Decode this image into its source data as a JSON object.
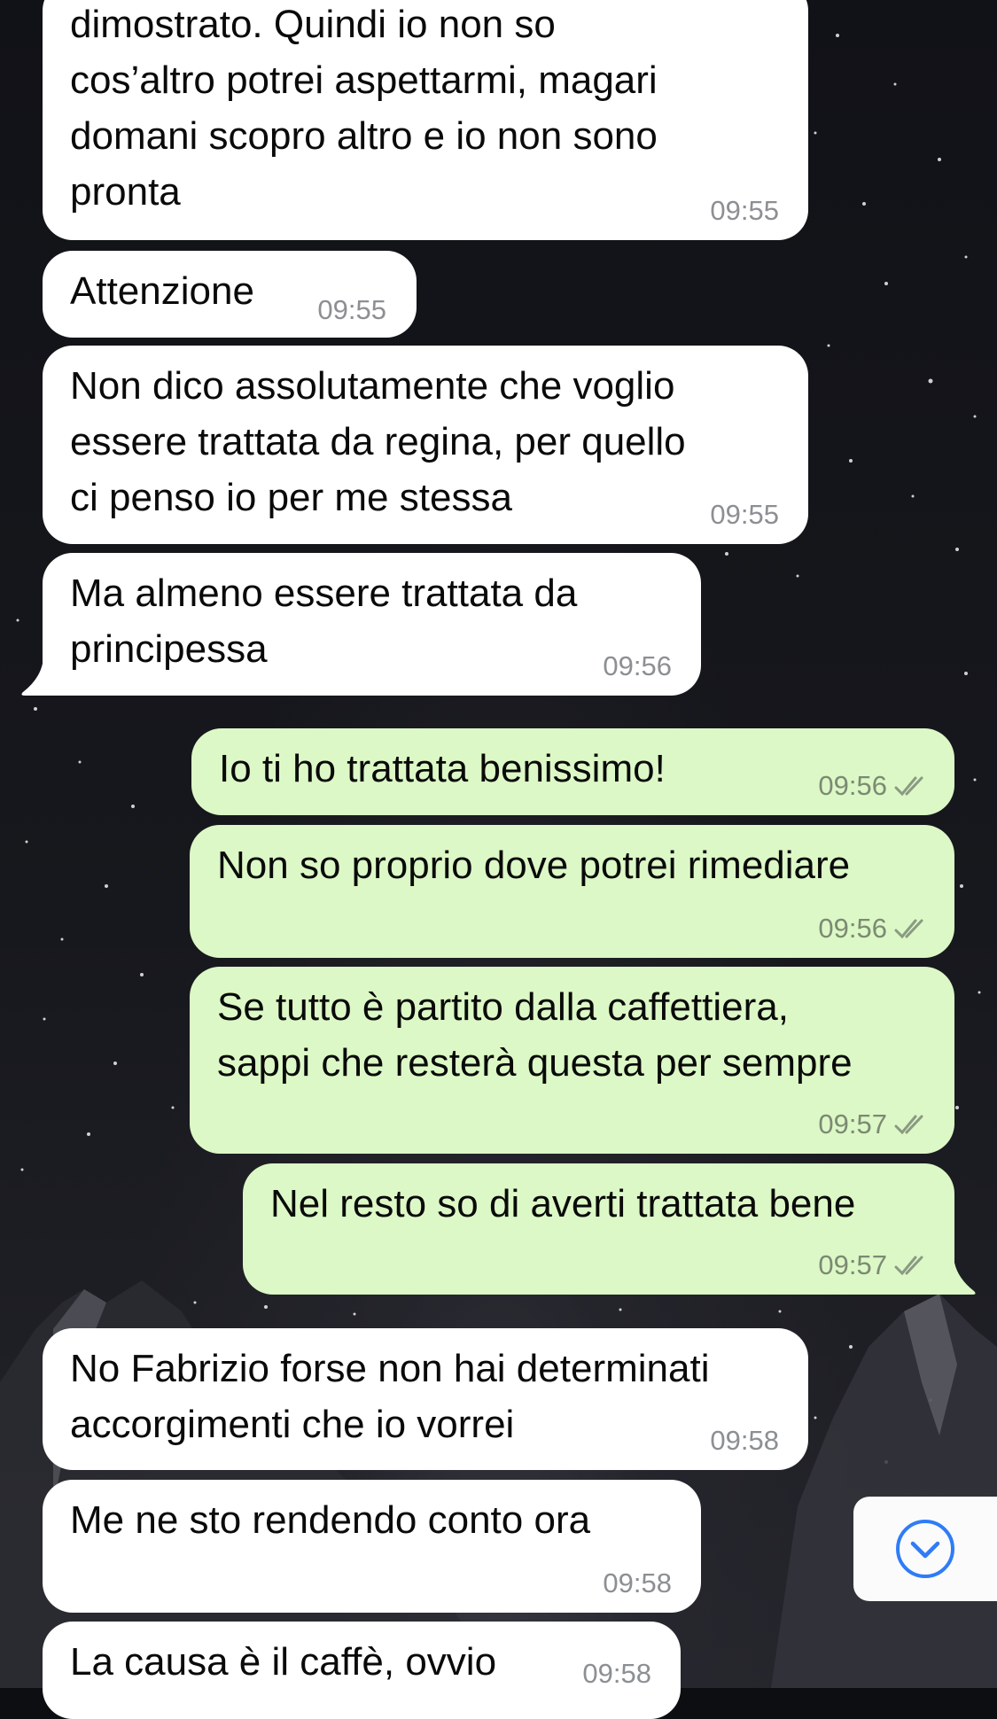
{
  "chat": {
    "messages": [
      {
        "id": "m1",
        "direction": "incoming",
        "text": "dimostrato. Quindi io non so\ncos’altro potrei aspettarmi, magari\ndomani scopro altro e io non sono\npronta",
        "time": "09:55"
      },
      {
        "id": "m2",
        "direction": "incoming",
        "text": "Attenzione",
        "time": "09:55"
      },
      {
        "id": "m3",
        "direction": "incoming",
        "text": "Non dico assolutamente che voglio\nessere trattata da regina, per quello\nci penso io per me stessa",
        "time": "09:55"
      },
      {
        "id": "m4",
        "direction": "incoming",
        "text": "Ma almeno essere trattata da\nprincipessa",
        "time": "09:56"
      },
      {
        "id": "m5",
        "direction": "outgoing",
        "text": "Io ti ho trattata benissimo!",
        "time": "09:56",
        "status": "read"
      },
      {
        "id": "m6",
        "direction": "outgoing",
        "text": "Non so proprio dove potrei rimediare",
        "time": "09:56",
        "status": "read"
      },
      {
        "id": "m7",
        "direction": "outgoing",
        "text": "Se tutto è partito dalla caffettiera,\nsappi che resterà questa per sempre",
        "time": "09:57",
        "status": "read"
      },
      {
        "id": "m8",
        "direction": "outgoing",
        "text": "Nel resto so di averti trattata bene",
        "time": "09:57",
        "status": "read"
      },
      {
        "id": "m9",
        "direction": "incoming",
        "text": "No Fabrizio forse non hai determinati\naccorgimenti che io vorrei",
        "time": "09:58"
      },
      {
        "id": "m10",
        "direction": "incoming",
        "text": "Me ne sto rendendo conto ora",
        "time": "09:58"
      },
      {
        "id": "m11",
        "direction": "incoming",
        "text": "La causa è il caffè, ovvio",
        "time": "09:58"
      }
    ]
  },
  "scroll_button": {
    "icon": "chevron-down-icon"
  },
  "colors": {
    "incoming_bubble": "#ffffff",
    "outgoing_bubble": "#dcf8c6",
    "timestamp": "#8c8f93",
    "scroll_icon": "#2f7cf6"
  }
}
